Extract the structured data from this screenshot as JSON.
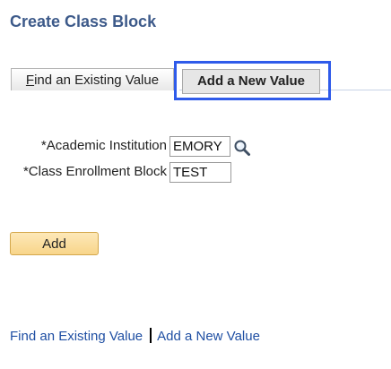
{
  "page": {
    "title": "Create Class Block"
  },
  "tabs": [
    {
      "mnemonic": "F",
      "rest": "ind an Existing Value",
      "active": false
    },
    {
      "label": "Add a New Value",
      "active": true
    }
  ],
  "form": {
    "academic_institution": {
      "label": "*Academic Institution",
      "value": "EMORY"
    },
    "class_enrollment_block": {
      "label": "*Class Enrollment Block",
      "value": "TEST"
    }
  },
  "actions": {
    "add_label": "Add"
  },
  "links": {
    "find_existing": "Find an Existing Value",
    "add_new": "Add a New Value"
  },
  "colors": {
    "title": "#3d5a8a",
    "focus_ring": "#2f5bea",
    "link": "#1f4fa3",
    "add_button": "#f8d58a"
  },
  "icons": {
    "lookup": "magnifier-icon"
  }
}
